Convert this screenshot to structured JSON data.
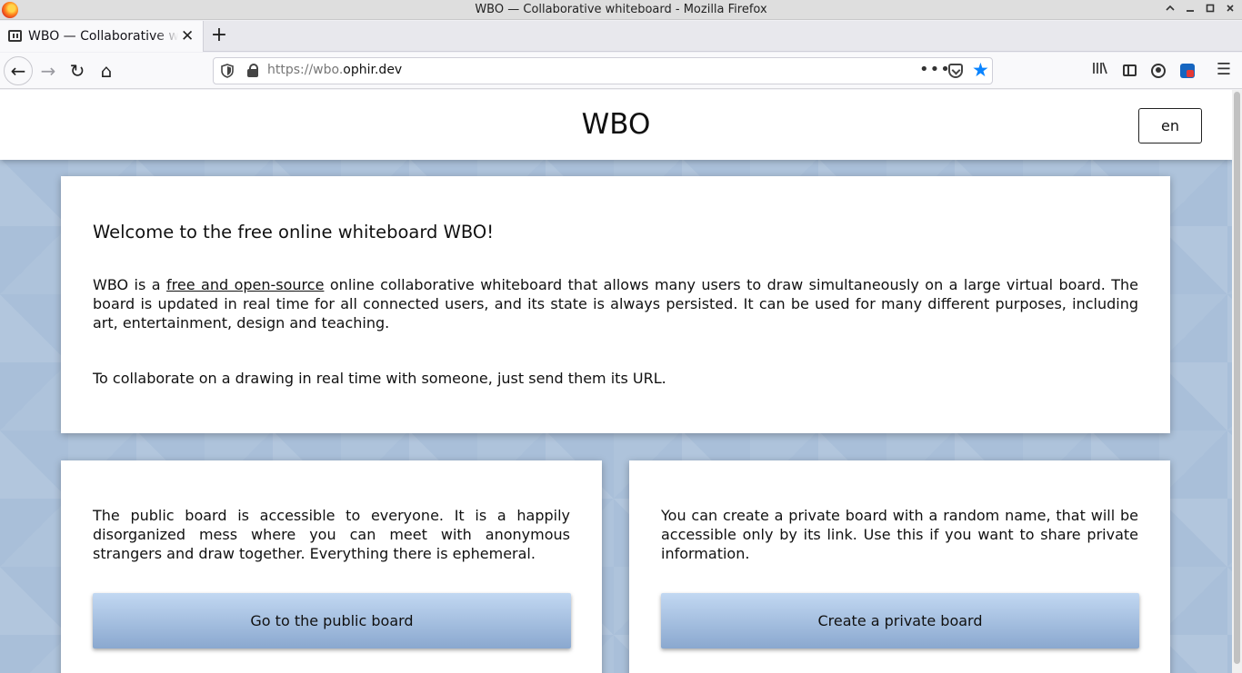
{
  "window": {
    "title": "WBO — Collaborative whiteboard - Mozilla Firefox",
    "controls": {
      "minimize": "▁",
      "maximize": "□",
      "close": "✕"
    }
  },
  "tabs": [
    {
      "title": "WBO — Collaborative whiteboard",
      "close": "✕",
      "active": true
    }
  ],
  "toolbar": {
    "new_tab": "+",
    "back": "←",
    "forward": "→",
    "reload": "↻",
    "home": "⌂",
    "url_prefix": "https://wbo.",
    "url_host": "ophir.dev",
    "page_actions": "•••",
    "bookmark_star": "★",
    "library": "|||\\",
    "menu": "☰",
    "bookmarked": true
  },
  "site": {
    "title": "WBO",
    "language": "en"
  },
  "intro": {
    "heading": "Welcome to the free online whiteboard WBO!",
    "p1_before": "WBO is a ",
    "p1_link": "free and open-source",
    "p1_after": " online collaborative whiteboard that allows many users to draw simultaneously on a large virtual board. The board is updated in real time for all connected users, and its state is always persisted. It can be used for many different purposes, including art, entertainment, design and teaching.",
    "p2": "To collaborate on a drawing in real time with someone, just send them its URL."
  },
  "public_board": {
    "description": "The public board is accessible to everyone. It is a happily disorganized mess where you can meet with anonymous strangers and draw together. Everything there is ephemeral.",
    "button": "Go to the public board"
  },
  "private_board": {
    "description": "You can create a private board with a random name, that will be accessible only by its link. Use this if you want to share private information.",
    "button": "Create a private board"
  },
  "colors": {
    "page_background": "#a9bfd9",
    "button_gradient_top": "#c2d8f2",
    "button_gradient_bottom": "#8aa8cf",
    "bookmark_star": "#0a84ff"
  },
  "icons": [
    "firefox-logo-icon",
    "favicon-icon",
    "shield-icon",
    "lock-icon",
    "pocket-icon",
    "star-icon",
    "library-icon",
    "sidebar-icon",
    "account-icon",
    "extension-icon",
    "menu-icon"
  ]
}
